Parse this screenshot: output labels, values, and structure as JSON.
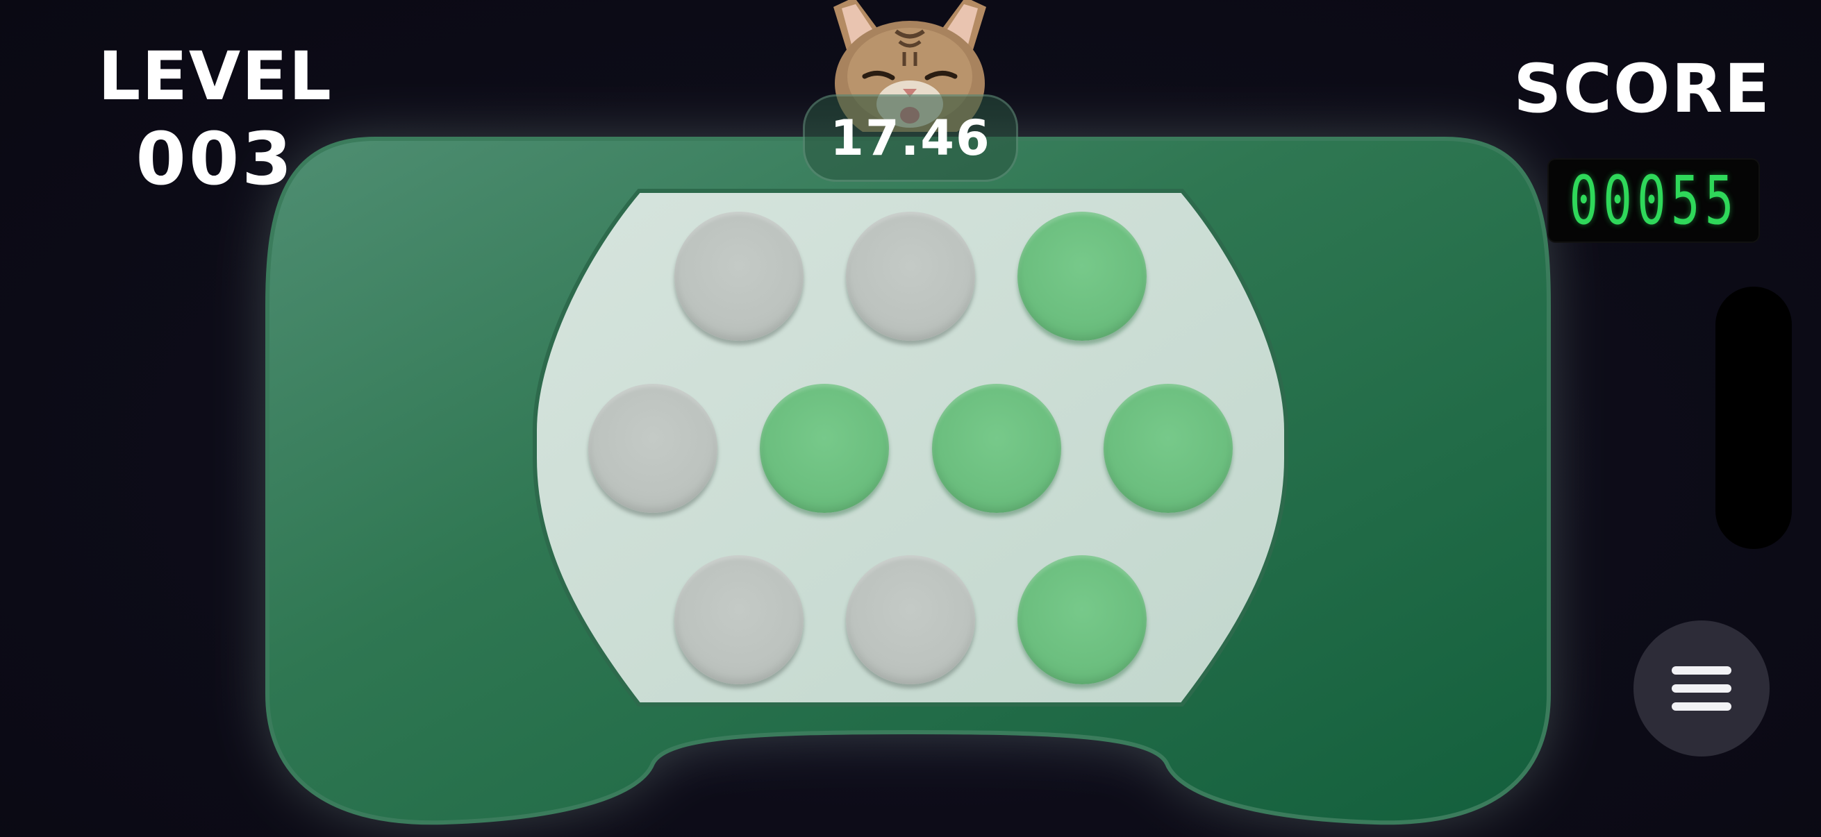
{
  "hud": {
    "level_label": "LEVEL",
    "level_value": "003",
    "score_label": "SCORE",
    "score_value": "00055"
  },
  "timer": {
    "value": "17.46",
    "mascot": "cat-face"
  },
  "board": {
    "colors": {
      "body": "#1c6b45",
      "tray": "#c8dbd2",
      "pop_active": "#6cbf7f",
      "pop_inactive": "#bdc3bf",
      "score_digits": "#2fd85a"
    },
    "rows": [
      [
        false,
        false,
        true
      ],
      [
        false,
        true,
        true,
        true
      ],
      [
        false,
        false,
        true
      ]
    ]
  },
  "menu": {
    "icon": "hamburger-menu-icon"
  }
}
